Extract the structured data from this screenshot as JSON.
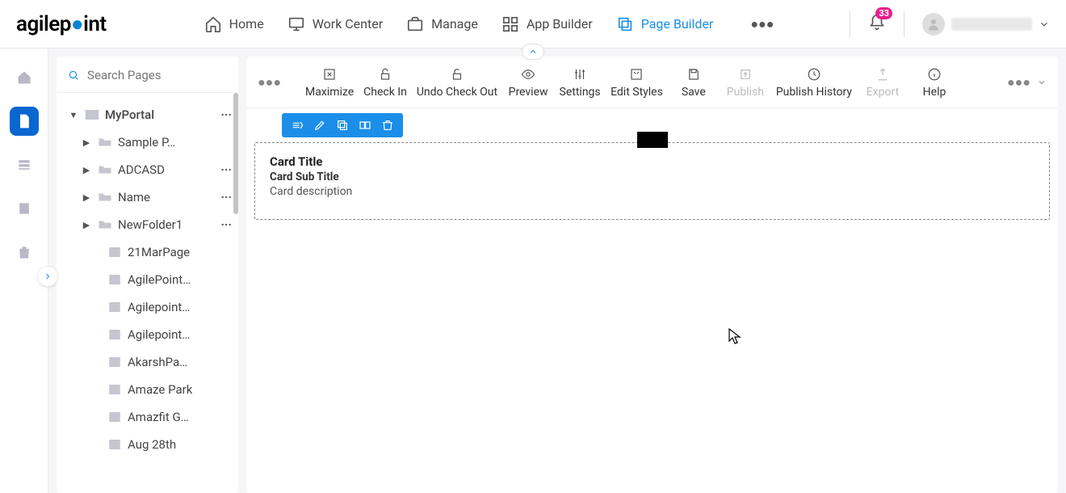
{
  "header": {
    "logo_text_pre": "agilep",
    "logo_text_post": "int",
    "nav": [
      {
        "label": "Home"
      },
      {
        "label": "Work Center"
      },
      {
        "label": "Manage"
      },
      {
        "label": "App Builder"
      },
      {
        "label": "Page Builder"
      }
    ],
    "notification_count": "33"
  },
  "search": {
    "placeholder": "Search Pages"
  },
  "tree": {
    "root": {
      "label": "MyPortal"
    },
    "folders": [
      {
        "label": "Sample P…"
      },
      {
        "label": "ADCASD"
      },
      {
        "label": "Name"
      },
      {
        "label": "NewFolder1"
      }
    ],
    "pages": [
      {
        "label": "21MarPage"
      },
      {
        "label": "AgilePoint…"
      },
      {
        "label": "Agilepoint…"
      },
      {
        "label": "Agilepoint…"
      },
      {
        "label": "AkarshPa…"
      },
      {
        "label": "Amaze Park"
      },
      {
        "label": "Amazfit G…"
      },
      {
        "label": "Aug 28th"
      }
    ]
  },
  "toolbar": [
    {
      "label": "Maximize"
    },
    {
      "label": "Check In"
    },
    {
      "label": "Undo Check Out"
    },
    {
      "label": "Preview"
    },
    {
      "label": "Settings"
    },
    {
      "label": "Edit Styles"
    },
    {
      "label": "Save"
    },
    {
      "label": "Publish",
      "disabled": true
    },
    {
      "label": "Publish History"
    },
    {
      "label": "Export",
      "disabled": true
    },
    {
      "label": "Help"
    }
  ],
  "card": {
    "title": "Card Title",
    "subtitle": "Card Sub Title",
    "description": "Card description"
  }
}
